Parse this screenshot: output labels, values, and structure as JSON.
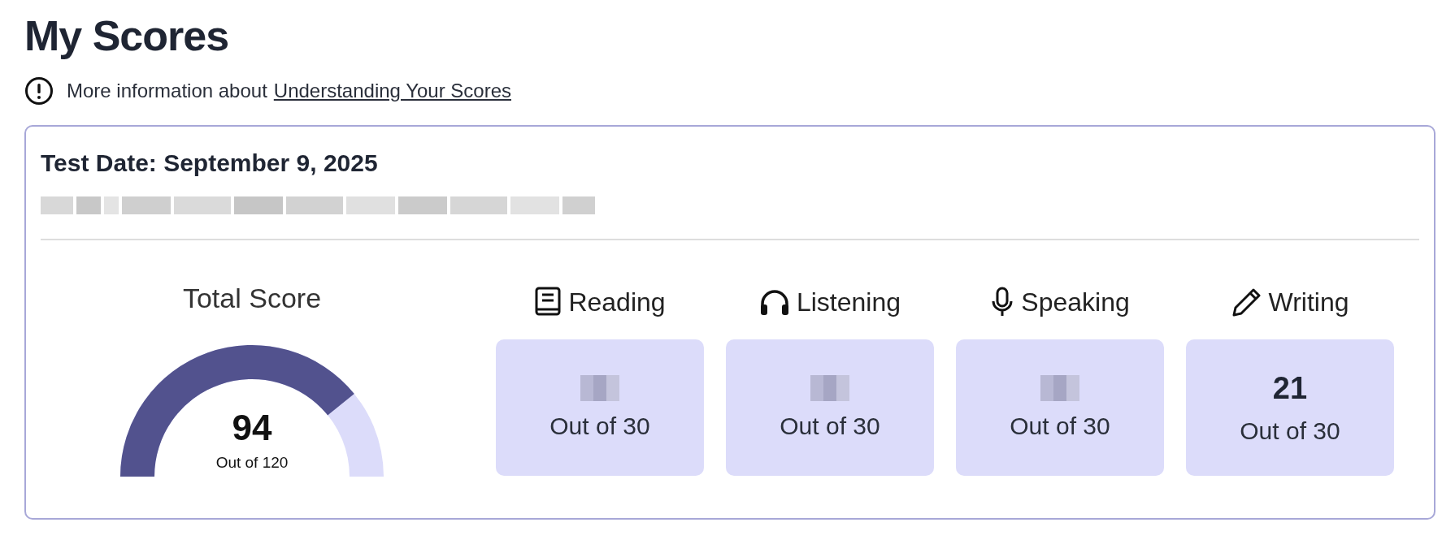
{
  "title": "My Scores",
  "info": {
    "text": "More information about",
    "link": "Understanding Your Scores"
  },
  "card": {
    "test_date": "Test Date: September 9, 2025",
    "details_blurred": true,
    "total": {
      "label": "Total Score",
      "score": "94",
      "out_of": "Out of 120"
    },
    "sections": [
      {
        "kind": "book",
        "name": "Reading",
        "out_of": "Out of 30"
      },
      {
        "kind": "headphones",
        "name": "Listening",
        "out_of": "Out of 30"
      },
      {
        "kind": "microphone",
        "name": "Speaking",
        "out_of": "Out of 30"
      },
      {
        "kind": "pencil",
        "name": "Writing",
        "score": "21",
        "out_of": "Out of 30"
      }
    ]
  }
}
